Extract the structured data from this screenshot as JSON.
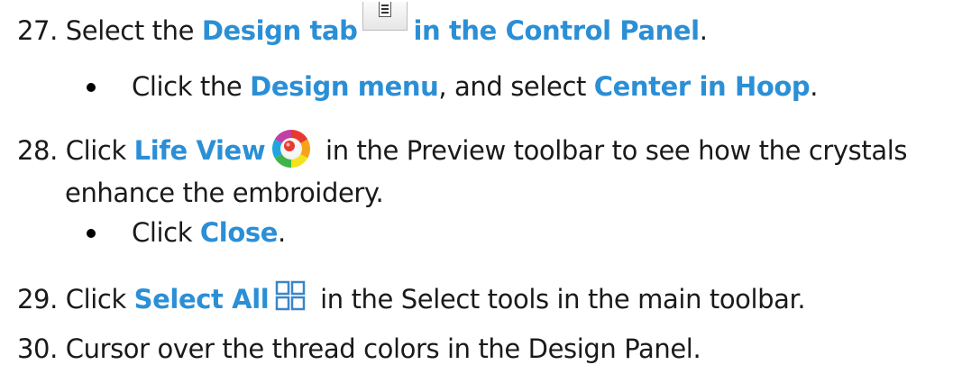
{
  "steps": [
    {
      "number": "27.",
      "parts": [
        "Select the ",
        "Design tab",
        " ",
        "in the Control Panel",
        "."
      ],
      "icon": "design-tab-icon",
      "bullets": [
        {
          "parts": [
            "Click the ",
            "Design menu",
            ", and select ",
            "Center in Hoop",
            "."
          ]
        }
      ]
    },
    {
      "number": "28.",
      "parts": [
        "Click ",
        "Life View",
        " in the Preview toolbar to see how the crystals"
      ],
      "continuation": "enhance the embroidery.",
      "icon": "life-view-icon",
      "bullets": [
        {
          "parts": [
            "Click ",
            "Close",
            "."
          ]
        }
      ]
    },
    {
      "number": "29.",
      "parts": [
        "Click ",
        "Select All",
        " in the Select tools in the main toolbar."
      ],
      "icon": "select-all-icon"
    },
    {
      "number": "30.",
      "parts": [
        "Cursor over the thread colors in the Design Panel."
      ]
    }
  ],
  "colors": {
    "highlight": "#2b8fd6",
    "text": "#1a1a1a",
    "select_all_icon": "#3a86c8"
  }
}
